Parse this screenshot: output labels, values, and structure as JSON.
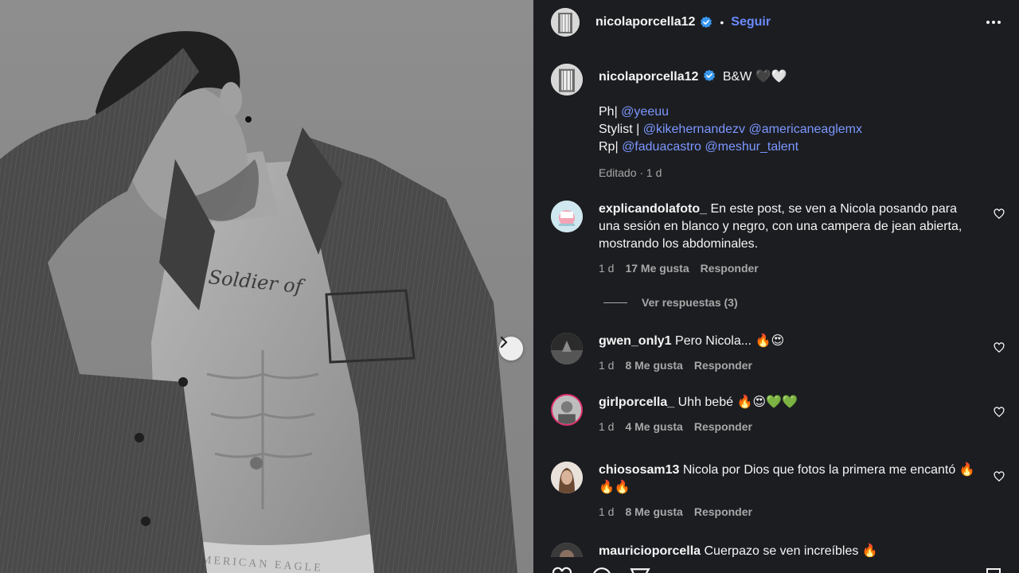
{
  "post": {
    "username": "nicolaporcella12",
    "separator": "•",
    "follow_label": "Seguir"
  },
  "caption": {
    "username": "nicolaporcella12",
    "title": "B&W 🖤🤍",
    "lines": [
      {
        "prefix": "Ph| ",
        "mentions": [
          "@yeeuu"
        ]
      },
      {
        "prefix": "Stylist | ",
        "mentions": [
          "@kikehernandezv",
          "@americaneaglemx"
        ]
      },
      {
        "prefix": "Rp| ",
        "mentions": [
          "@faduacastro",
          "@meshur_talent"
        ]
      }
    ],
    "edited": "Editado · 1 d"
  },
  "comments": [
    {
      "username": "explicandolafoto_",
      "text": "En este post, se ven a Nicola posando para una sesión en blanco y negro, con una campera de jean abierta, mostrando los abdominales.",
      "time": "1 d",
      "likes": "17 Me gusta",
      "reply": "Responder"
    },
    {
      "username": "gwen_only1",
      "text": "Pero Nicola... 🔥😍",
      "time": "1 d",
      "likes": "8 Me gusta",
      "reply": "Responder"
    },
    {
      "username": "girlporcella_",
      "text": "Uhh bebé 🔥😍💚💚",
      "time": "1 d",
      "likes": "4 Me gusta",
      "reply": "Responder"
    },
    {
      "username": "chiososam13",
      "text": "Nicola por Dios que fotos la primera me encantó 🔥🔥🔥",
      "time": "1 d",
      "likes": "8 Me gusta",
      "reply": "Responder"
    },
    {
      "username": "mauricioporcella",
      "text": "Cuerpazo se ven increíbles 🔥"
    }
  ],
  "view_replies": "Ver respuestas (3)",
  "photo": {
    "waistband_text": "AMERICAN EAGLE",
    "tattoo_text": "Soldier of"
  },
  "icons": {
    "verified": "verified-badge-icon",
    "more": "more-options-icon",
    "heart": "heart-icon",
    "next": "chevron-right-icon"
  },
  "colors": {
    "panel_bg": "#1c1d21",
    "link": "#7b97ff",
    "follow": "#6b8bff",
    "verified": "#3897f0"
  }
}
